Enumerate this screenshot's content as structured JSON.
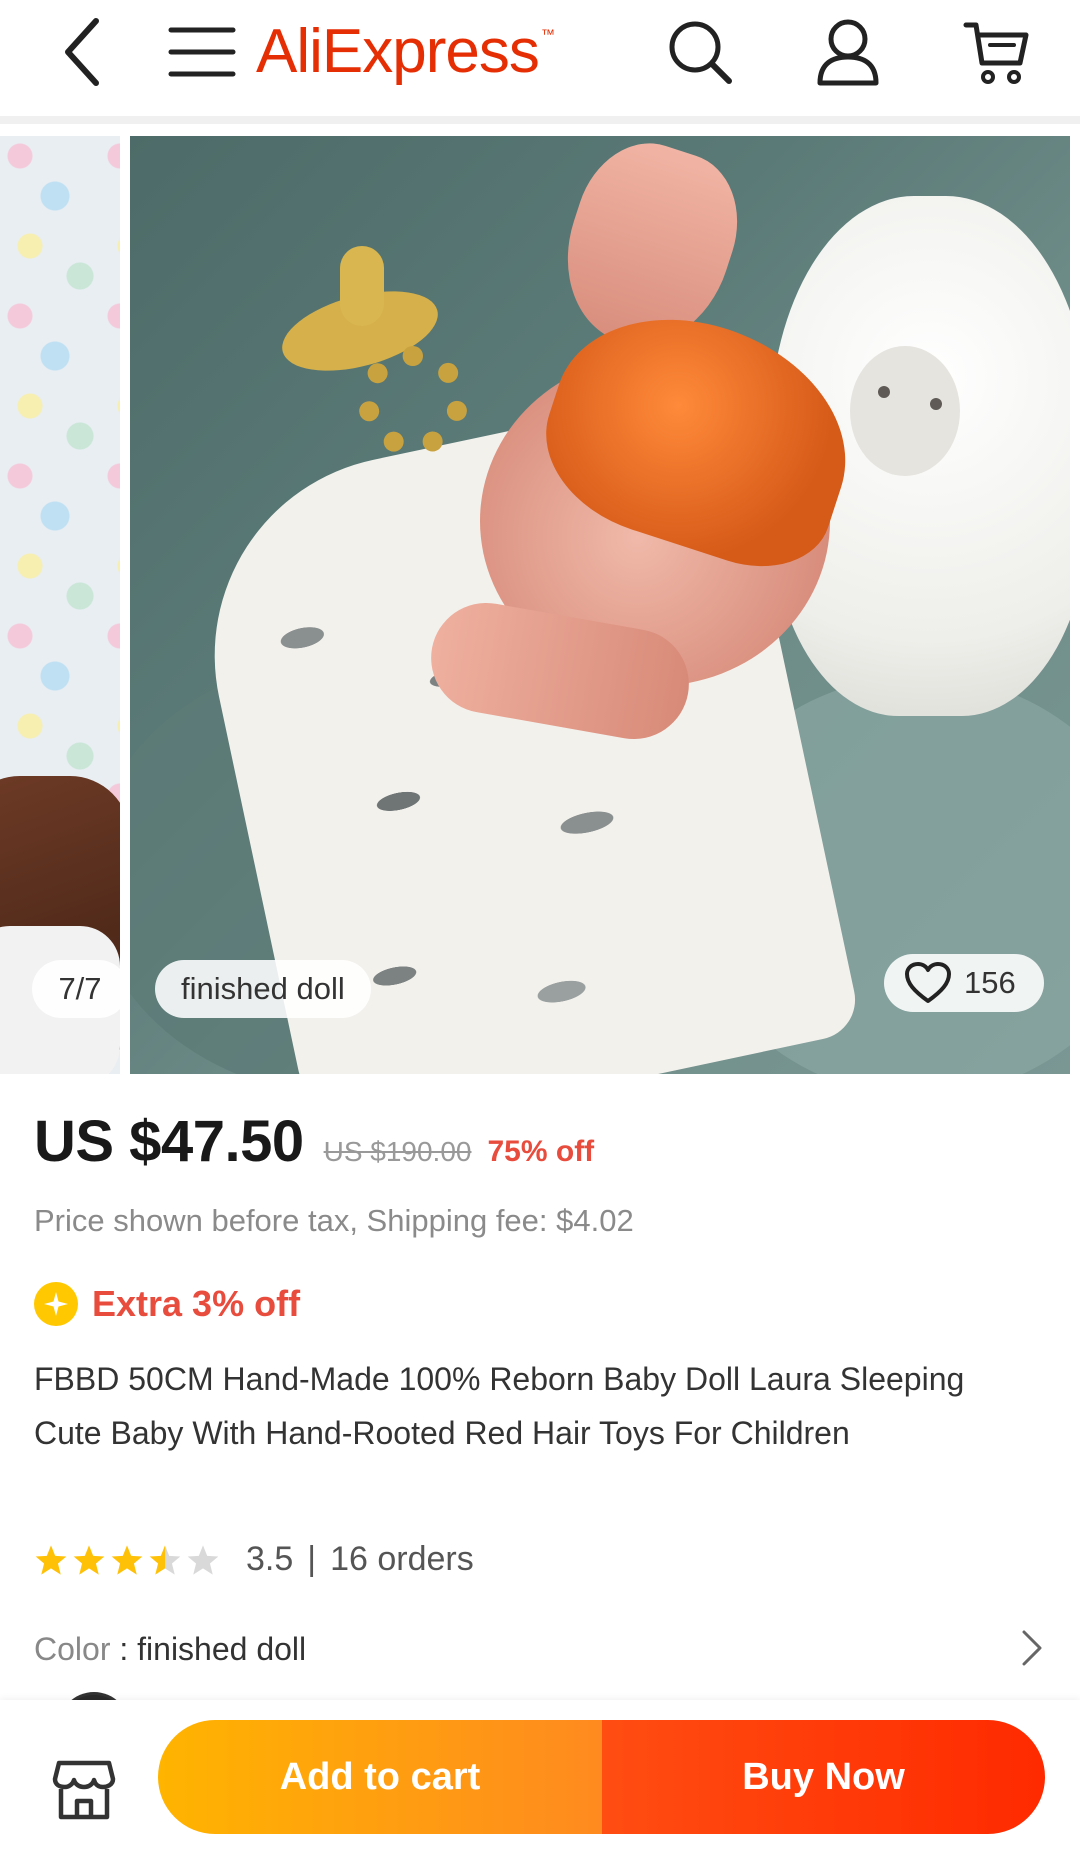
{
  "header": {
    "logo_text": "AliExpress",
    "logo_tm": "™",
    "logo_color": "#e62e04",
    "icons": [
      "back-icon",
      "menu-icon",
      "search-icon",
      "user-icon",
      "cart-icon"
    ]
  },
  "gallery": {
    "index_label": "7/7",
    "variant_label": "finished doll",
    "like_count": "156"
  },
  "product": {
    "price": "US $47.50",
    "original_price": "US $190.00",
    "discount": "75% off",
    "tax_note": "Price shown before tax, Shipping fee: $4.02",
    "extra_discount": "Extra 3% off",
    "title": "FBBD 50CM Hand-Made 100% Reborn Baby Doll Laura Sleeping Cute Baby With Hand-Rooted Red Hair Toys For Children",
    "rating": "3.5",
    "rating_stars": 3.5,
    "rating_separator": "|",
    "orders": "16 orders",
    "color_label": "Color",
    "color_separator": " : ",
    "color_value": "finished doll"
  },
  "actions": {
    "add_to_cart": "Add to cart",
    "buy_now": "Buy Now",
    "cart_color": "#ffa00f",
    "buy_color": "#ff3a0a"
  }
}
